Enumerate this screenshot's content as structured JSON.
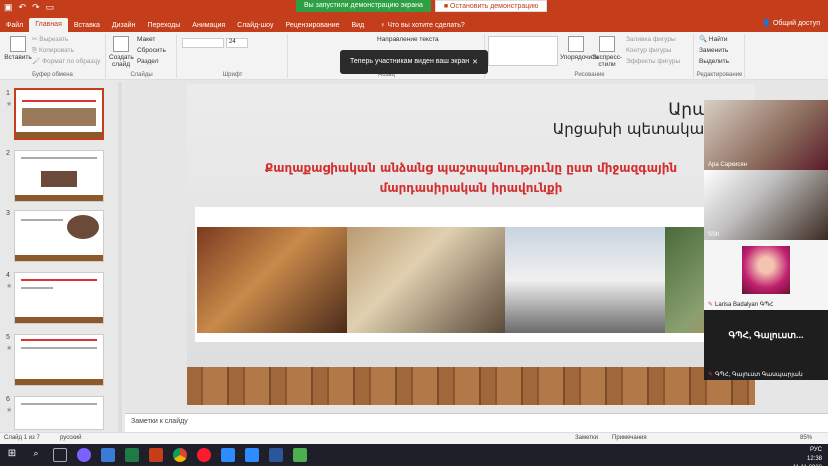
{
  "qat": {
    "file": "Файл"
  },
  "sharing": {
    "banner": "Вы запустили демонстрацию экрана",
    "stop": "Остановить демонстрацию"
  },
  "tabs": [
    "Главная",
    "Вставка",
    "Дизайн",
    "Переходы",
    "Анимация",
    "Слайд-шоу",
    "Рецензирование",
    "Вид"
  ],
  "tellme": "Что вы хотите сделать?",
  "share": "Общий доступ",
  "ribbon": {
    "paste": "Вставить",
    "cut": "Вырезать",
    "copy": "Копировать",
    "format": "Формат по образцу",
    "clipboard": "Буфер обмена",
    "new_slide": "Создать слайд",
    "layout": "Макет",
    "reset": "Сбросить",
    "section": "Раздел",
    "slides": "Слайды",
    "font_size": "24",
    "font": "Шрифт",
    "text_dir": "Направление текста",
    "paragraph": "Абзац",
    "arrange": "Упорядочить",
    "styles": "Экспресс-стили",
    "fill": "Заливка фигуры",
    "outline": "Контур фигуры",
    "effects": "Эффекты фигуры",
    "drawing": "Рисование",
    "find": "Найти",
    "replace": "Заменить",
    "select": "Выделить",
    "editing": "Редактирование"
  },
  "toast": "Теперь участникам виден ваш экран",
  "slide": {
    "title": "Արա Սարգ",
    "subtitle": "Արցախի պետական համալսա",
    "red_line1": "Քաղաքացիական անձանց պաշտպանությունը ըստ միջազգային",
    "red_line2": "մարդասիրական իրավունքի"
  },
  "thumbs": [
    {
      "num": "1"
    },
    {
      "num": "2"
    },
    {
      "num": "3"
    },
    {
      "num": "4"
    },
    {
      "num": "5"
    },
    {
      "num": "6"
    }
  ],
  "videos": [
    {
      "name": "Ара Саркисян"
    },
    {
      "name": "SSh"
    },
    {
      "name": "Larisa Badalyan ԳՊՀ"
    },
    {
      "name": "ԳՊՀ, Գալուստ..."
    },
    {
      "name": "ԳՊՀ, Գալուստ Գասպարյան"
    }
  ],
  "notes": "Заметки к слайду",
  "status": {
    "slide": "Слайд 1 из 7",
    "lang": "русский",
    "notes": "Заметки",
    "comments": "Примечания",
    "zoom": "85%"
  },
  "tray": {
    "lang": "РУС",
    "time": "12:38",
    "date": "11.11.2022"
  }
}
